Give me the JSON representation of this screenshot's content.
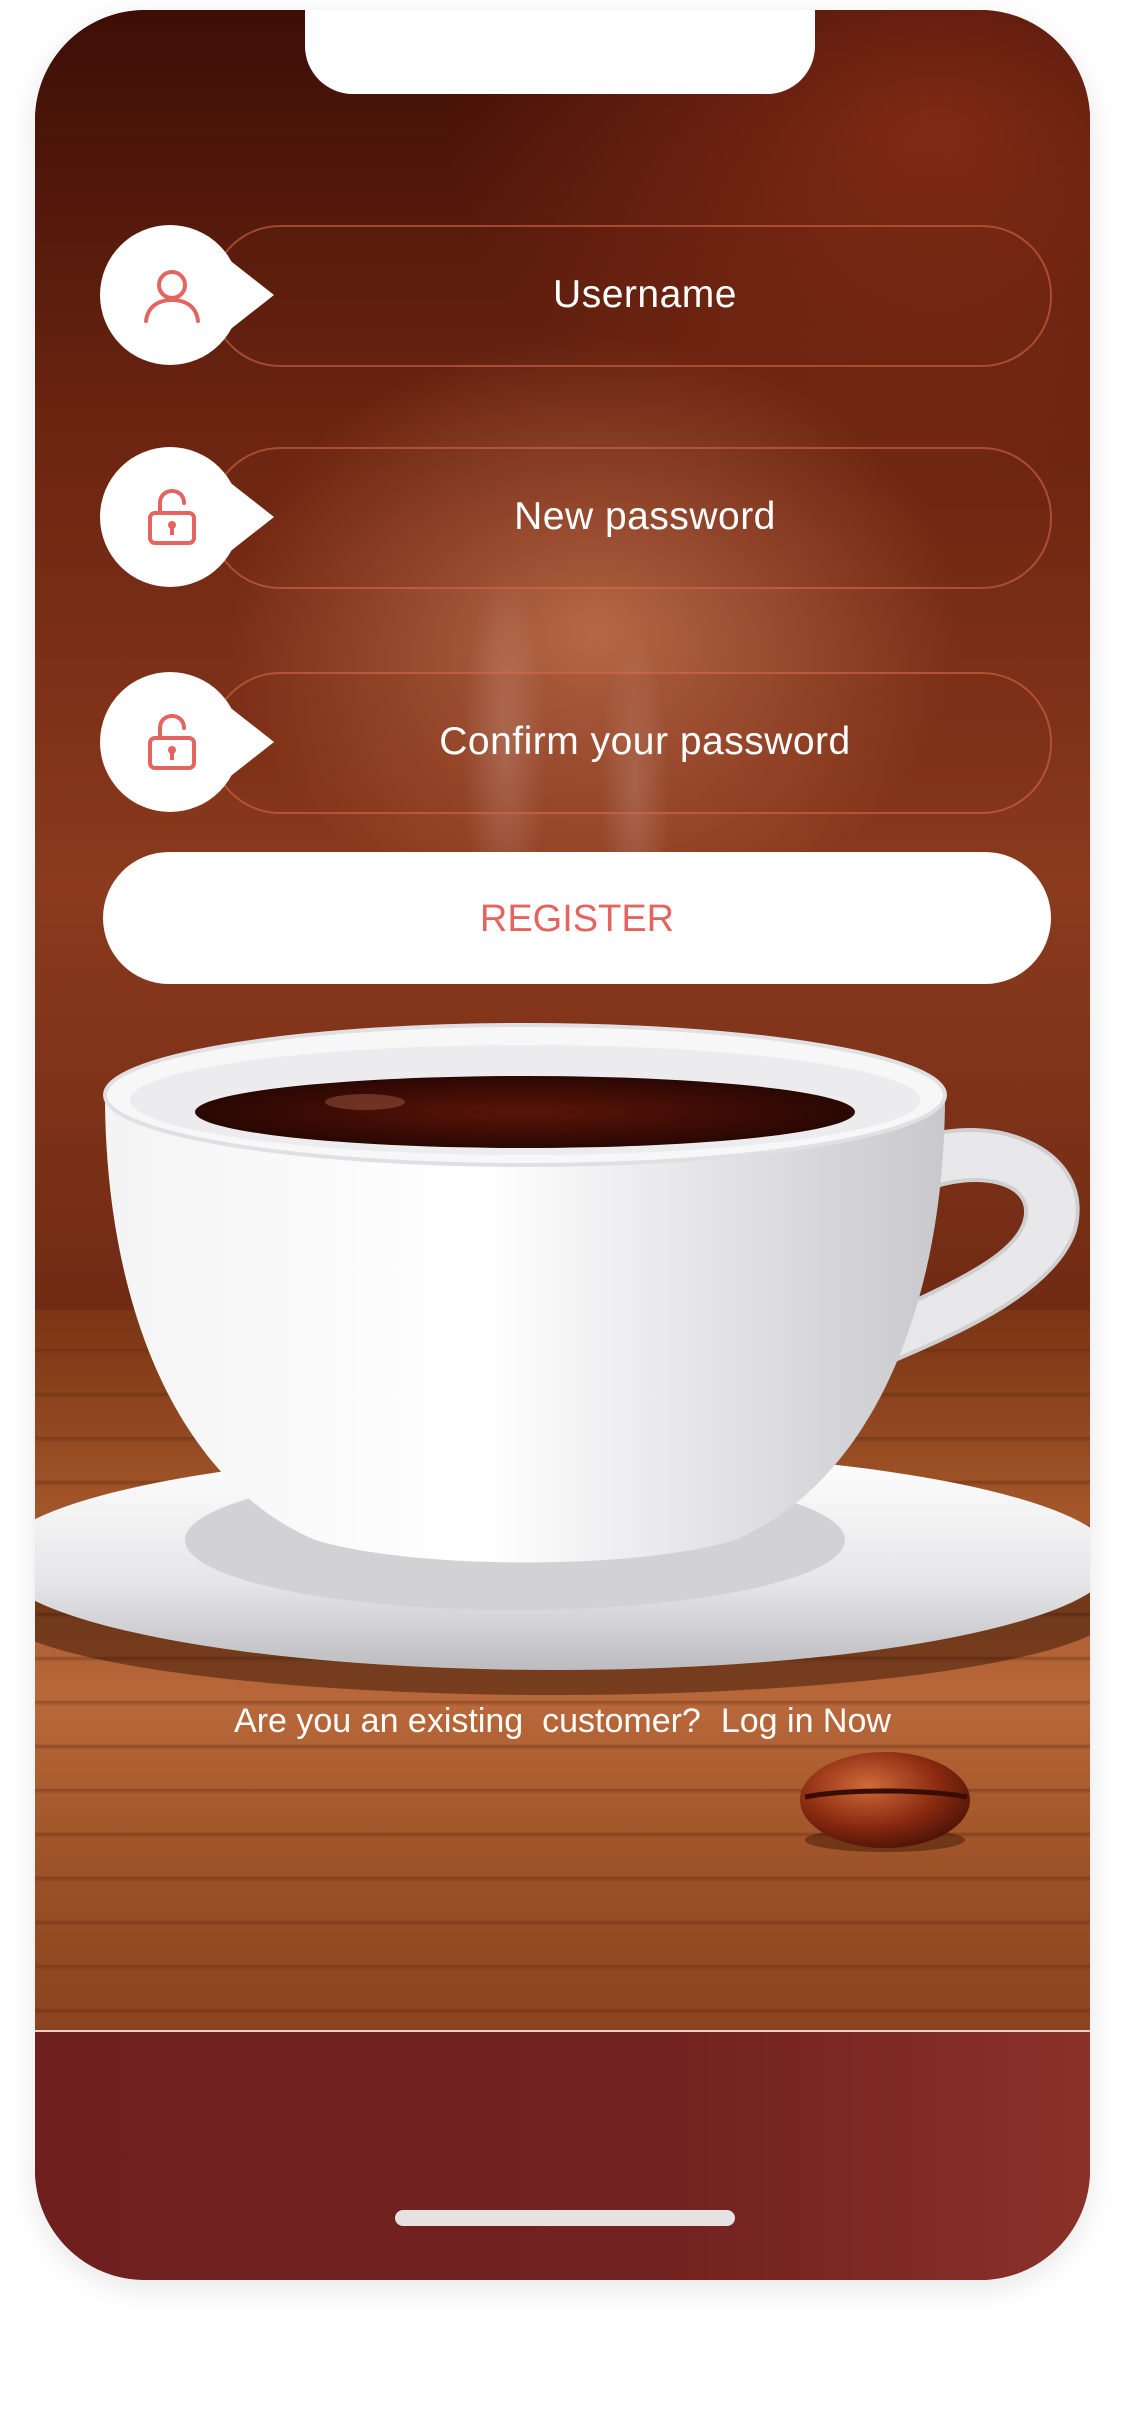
{
  "form": {
    "username_placeholder": "Username",
    "new_password_placeholder": "New password",
    "confirm_password_placeholder": "Confirm your password",
    "register_label": "REGISTER"
  },
  "footer": {
    "question": "Are you an existing  customer?",
    "login_link": "Log in Now"
  },
  "icons": {
    "username": "user-icon",
    "new_password": "unlock-icon",
    "confirm_password": "unlock-icon"
  },
  "colors": {
    "accent": "#e4645f",
    "bottom_bar": "#722220",
    "background_dark": "#5a1e10"
  }
}
